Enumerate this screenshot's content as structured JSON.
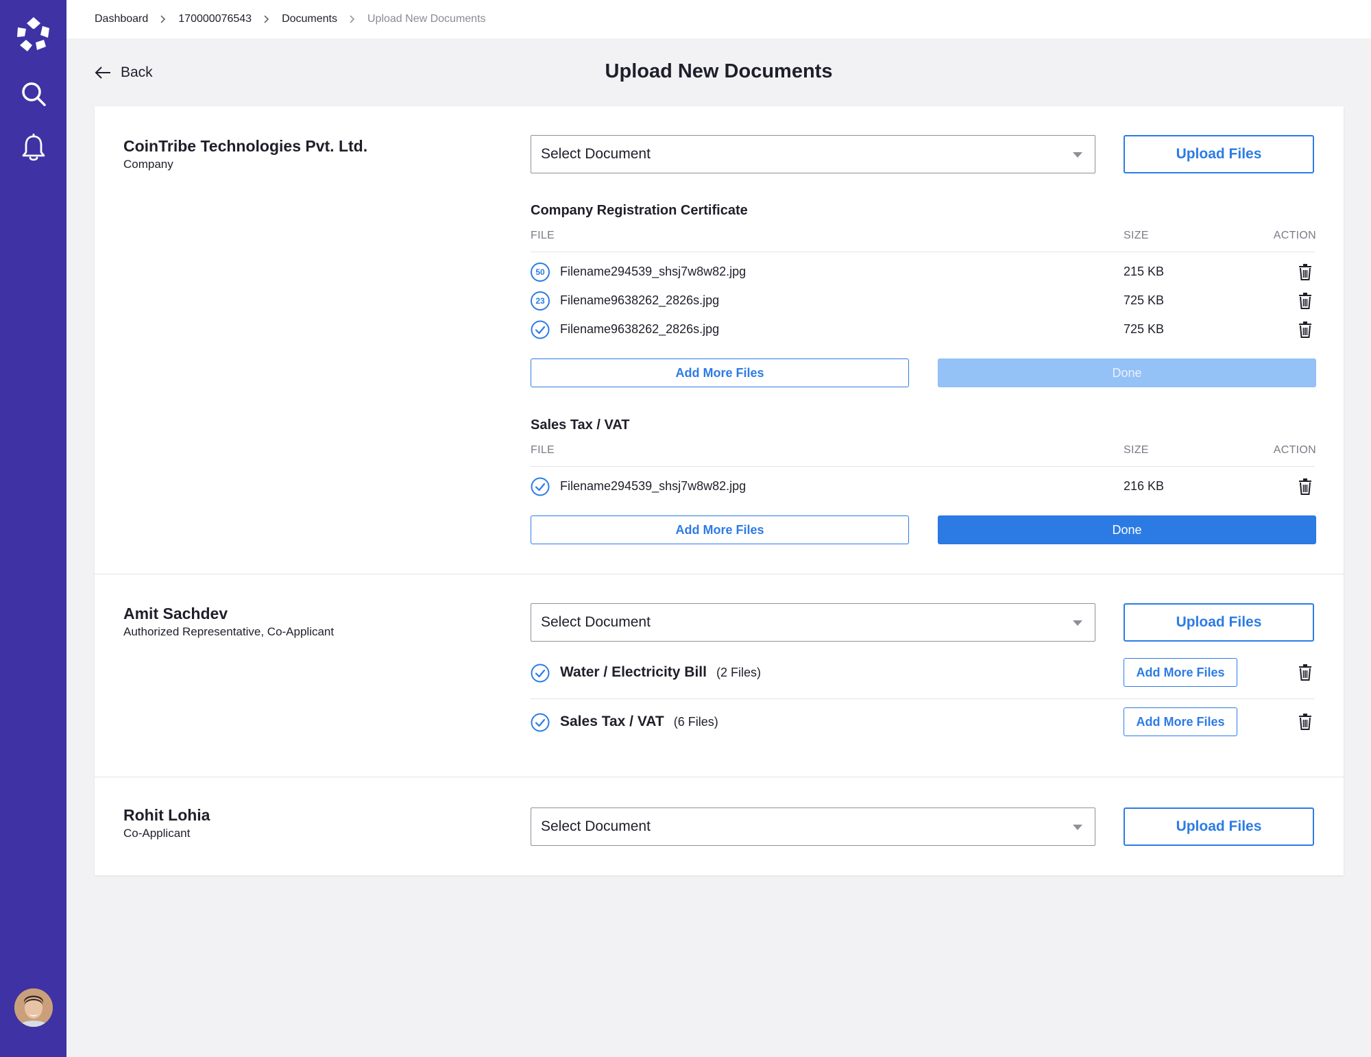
{
  "breadcrumb": [
    "Dashboard",
    "170000076543",
    "Documents",
    "Upload New Documents"
  ],
  "header": {
    "back_label": "Back",
    "title": "Upload New Documents"
  },
  "sidebar": {
    "icons": [
      "logo-icon",
      "search-icon",
      "bell-icon",
      "avatar"
    ]
  },
  "colors": {
    "sidebar": "#3f32a4",
    "accent": "#2c7be5",
    "done_disabled": "#94c1f6"
  },
  "sections": [
    {
      "name": "CoinTribe Technologies Pvt. Ltd.",
      "role": "Company",
      "select_placeholder": "Select Document",
      "upload_label": "Upload Files",
      "docs": [
        {
          "title": "Company Registration Certificate",
          "col_file": "FILE",
          "col_size": "SIZE",
          "col_action": "ACTION",
          "files": [
            {
              "status": "50",
              "name": "Filename294539_shsj7w8w82.jpg",
              "size": "215 KB"
            },
            {
              "status": "23",
              "name": "Filename9638262_2826s.jpg",
              "size": "725 KB"
            },
            {
              "status": "done",
              "name": "Filename9638262_2826s.jpg",
              "size": "725 KB"
            }
          ],
          "add_more_label": "Add More Files",
          "done_label": "Done",
          "done_enabled": false
        },
        {
          "title": "Sales Tax / VAT",
          "col_file": "FILE",
          "col_size": "SIZE",
          "col_action": "ACTION",
          "files": [
            {
              "status": "done",
              "name": "Filename294539_shsj7w8w82.jpg",
              "size": "216 KB"
            }
          ],
          "add_more_label": "Add More Files",
          "done_label": "Done",
          "done_enabled": true
        }
      ]
    },
    {
      "name": "Amit Sachdev",
      "role": "Authorized Representative, Co-Applicant",
      "select_placeholder": "Select Document",
      "upload_label": "Upload Files",
      "uploaded_docs": [
        {
          "name": "Water / Electricity Bill",
          "count": "(2 Files)",
          "add_more_label": "Add More Files"
        },
        {
          "name": "Sales Tax / VAT",
          "count": "(6 Files)",
          "add_more_label": "Add More Files"
        }
      ]
    },
    {
      "name": "Rohit Lohia",
      "role": "Co-Applicant",
      "select_placeholder": "Select Document",
      "upload_label": "Upload Files"
    }
  ]
}
